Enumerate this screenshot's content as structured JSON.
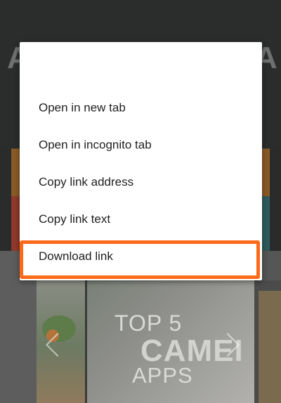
{
  "background": {
    "header_letters": [
      "A",
      "A"
    ],
    "promo": {
      "line1": "TOP 5",
      "line2": "CAMEI",
      "line3": "APPS"
    }
  },
  "context_menu": {
    "items": [
      {
        "label": "Open in new tab"
      },
      {
        "label": "Open in incognito tab"
      },
      {
        "label": "Copy link address"
      },
      {
        "label": "Copy link text"
      },
      {
        "label": "Download link"
      }
    ]
  },
  "highlight": {
    "target": "Download link",
    "color": "#ff6a1a"
  }
}
